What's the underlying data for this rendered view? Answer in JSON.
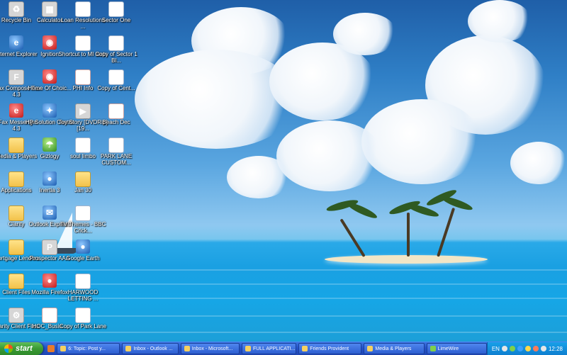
{
  "desktop": {
    "icons": [
      {
        "label": "Recycle Bin",
        "icon": "recycle-bin-icon",
        "glyph": "♻"
      },
      {
        "label": "Internet Explorer",
        "icon": "internet-explorer-icon",
        "glyph": "e"
      },
      {
        "label": "eFax Compose Fax 4.3",
        "icon": "efax-compose-icon",
        "glyph": "F"
      },
      {
        "label": "eFax Messenger 4.3",
        "icon": "efax-messenger-icon",
        "glyph": "e"
      },
      {
        "label": "Media & Players",
        "icon": "folder-icon",
        "glyph": ""
      },
      {
        "label": "Applications",
        "icon": "folder-icon",
        "glyph": ""
      },
      {
        "label": "Clarity",
        "icon": "folder-icon",
        "glyph": ""
      },
      {
        "label": "Mortgage Lenders",
        "icon": "folder-icon",
        "glyph": ""
      },
      {
        "label": "Client Files",
        "icon": "folder-icon",
        "glyph": ""
      },
      {
        "label": "Clarity Client Files",
        "icon": "clarity-client-files-icon",
        "glyph": "⚙"
      },
      {
        "label": "Calculator",
        "icon": "calculator-icon",
        "glyph": "▦"
      },
      {
        "label": "Ignition",
        "icon": "ignition-icon",
        "glyph": "◉"
      },
      {
        "label": "Home Of Choic...",
        "icon": "home-of-choices-icon",
        "glyph": "◉"
      },
      {
        "label": "HP Solution Center",
        "icon": "hp-solution-center-icon",
        "glyph": "✦"
      },
      {
        "label": "Gizlogy",
        "icon": "gizlogy-icon",
        "glyph": "☂"
      },
      {
        "label": "Inertia 3",
        "icon": "inertia-icon",
        "glyph": "●"
      },
      {
        "label": "Outlook Express",
        "icon": "outlook-express-icon",
        "glyph": "✉"
      },
      {
        "label": "Prospector AAA",
        "icon": "prospector-icon",
        "glyph": "P"
      },
      {
        "label": "Mozilla Firefox",
        "icon": "firefox-icon",
        "glyph": "●"
      },
      {
        "label": "HOC_Busin...",
        "icon": "pdf-file-icon",
        "glyph": "PDF"
      },
      {
        "label": "Loan Resolutions ...",
        "icon": "word-document-icon",
        "glyph": "W"
      },
      {
        "label": "Shortcut to MI stats",
        "icon": "excel-spreadsheet-icon",
        "glyph": "X"
      },
      {
        "label": "PHI Info",
        "icon": "pdf-file-icon",
        "glyph": "PDF"
      },
      {
        "label": "Toy Story [DVDRip][19...",
        "icon": "video-file-icon",
        "glyph": "▶"
      },
      {
        "label": "soul limbo",
        "icon": "audio-file-icon",
        "glyph": "♪"
      },
      {
        "label": "Jan 30",
        "icon": "folder-icon",
        "glyph": ""
      },
      {
        "label": "TV Themes - BBC Crick...",
        "icon": "audio-file-icon",
        "glyph": "♪"
      },
      {
        "label": "Google Earth",
        "icon": "google-earth-icon",
        "glyph": "●"
      },
      {
        "label": "HARWOOD LETTING ...",
        "icon": "word-document-icon",
        "glyph": "W"
      },
      {
        "label": "Copy of Park Lane",
        "icon": "excel-spreadsheet-icon",
        "glyph": "X"
      },
      {
        "label": "Sector One",
        "icon": "excel-spreadsheet-icon",
        "glyph": "X"
      },
      {
        "label": "Copy of Sector 1 Bl...",
        "icon": "excel-spreadsheet-icon",
        "glyph": "X"
      },
      {
        "label": "Copy of Cent...",
        "icon": "excel-spreadsheet-icon",
        "glyph": "X"
      },
      {
        "label": "Beach Dec",
        "icon": "pdf-file-icon",
        "glyph": "PDF"
      },
      {
        "label": "PARK LANE CUSTOM...",
        "icon": "word-document-icon",
        "glyph": "W"
      }
    ]
  },
  "taskbar": {
    "start_label": "start",
    "tasks": [
      "6: Topic: Post y...",
      "Inbox - Outlook ...",
      "Inbox - Microsoft...",
      "FULL APPLICATI...",
      "Friends Provident",
      "Media & Players",
      "LimeWire"
    ],
    "lang": "EN",
    "clock": "12:28"
  },
  "colors": {
    "taskbar": "#2452c7",
    "start": "#3a9a35",
    "tray": "#0f7fd0"
  }
}
